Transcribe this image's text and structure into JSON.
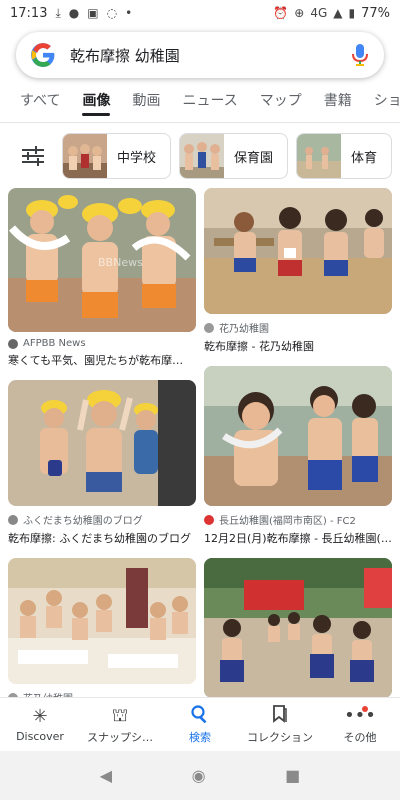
{
  "status_bar": {
    "time": "17:13",
    "network": "4G",
    "battery": "77%"
  },
  "search": {
    "query": "乾布摩擦 幼稚園"
  },
  "tabs": [
    {
      "label": "すべて",
      "active": false
    },
    {
      "label": "画像",
      "active": true
    },
    {
      "label": "動画",
      "active": false
    },
    {
      "label": "ニュース",
      "active": false
    },
    {
      "label": "マップ",
      "active": false
    },
    {
      "label": "書籍",
      "active": false
    },
    {
      "label": "ショ",
      "active": false
    }
  ],
  "chips": [
    {
      "label": "中学校"
    },
    {
      "label": "保育園"
    },
    {
      "label": "体育"
    }
  ],
  "results": {
    "left": [
      {
        "source": "AFPBB News",
        "title": "寒くても平気、園児たちが乾布摩…",
        "watermark": "BBNews"
      },
      {
        "source": "ふくだまち幼稚園のブログ",
        "title": "乾布摩擦: ふくだまち幼稚園のブログ"
      },
      {
        "source": "花乃幼稚園",
        "title": ""
      }
    ],
    "right": [
      {
        "source": "花乃幼稚園",
        "title": "乾布摩擦 - 花乃幼稚園"
      },
      {
        "source": "長丘幼稚園(福岡市南区) - FC2",
        "title": "12月2日(月)乾布摩擦 - 長丘幼稚園(…"
      },
      {
        "source": "",
        "title": ""
      }
    ]
  },
  "bottom_nav": [
    {
      "label": "Discover",
      "icon": "asterisk-icon",
      "active": false
    },
    {
      "label": "スナップシ…",
      "icon": "snapshot-icon",
      "active": false
    },
    {
      "label": "検索",
      "icon": "search-icon",
      "active": true
    },
    {
      "label": "コレクション",
      "icon": "bookmark-icon",
      "active": false
    },
    {
      "label": "その他",
      "icon": "more-icon",
      "active": false
    }
  ],
  "colors": {
    "accent": "#1a73e8",
    "google_blue": "#4285f4",
    "google_red": "#ea4335",
    "google_yellow": "#fbbc05",
    "google_green": "#34a853"
  }
}
